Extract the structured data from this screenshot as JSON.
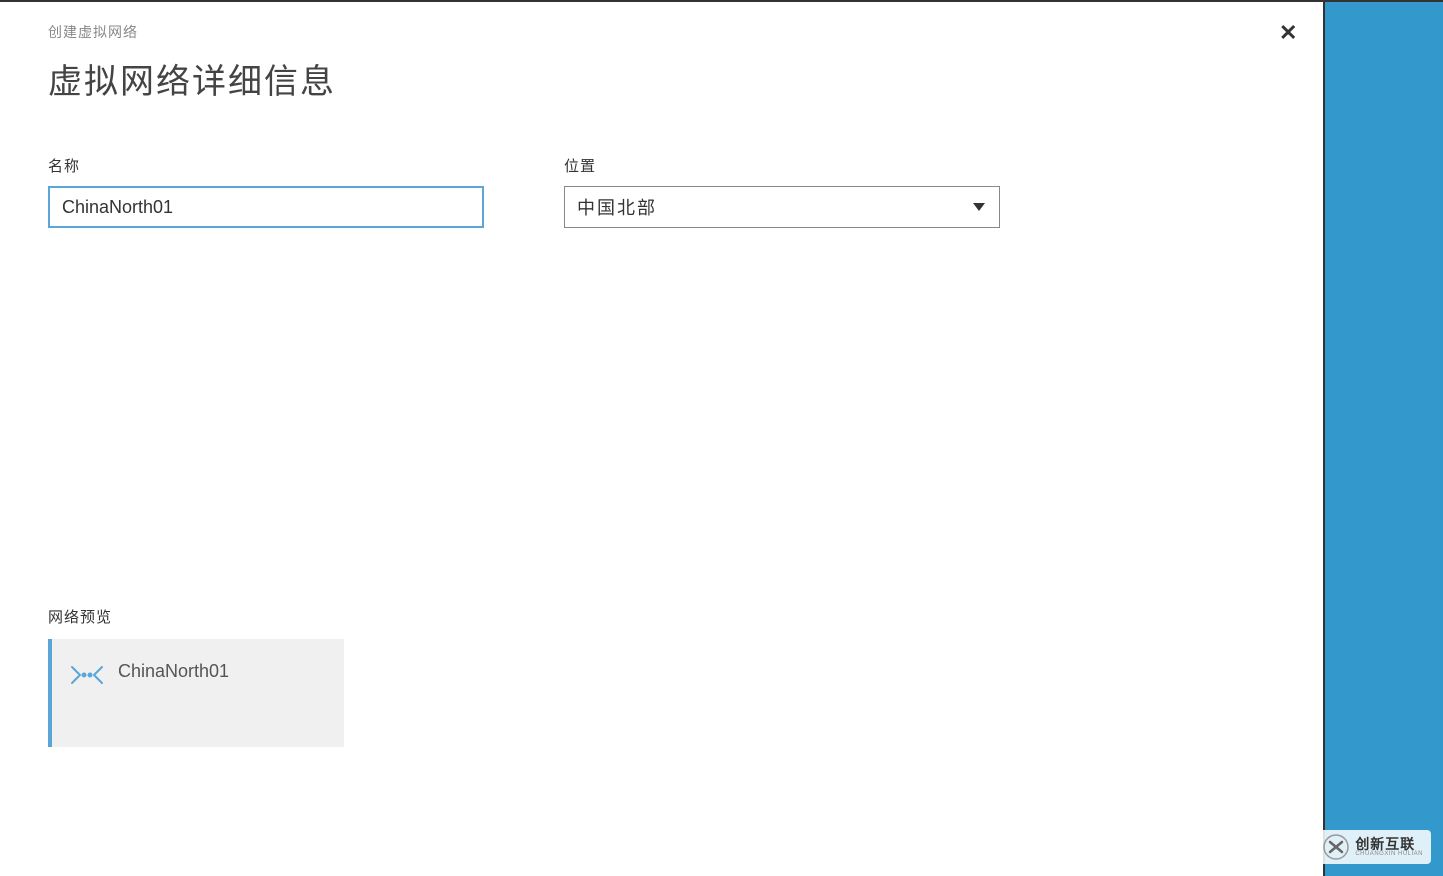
{
  "breadcrumb": "创建虚拟网络",
  "page_title": "虚拟网络详细信息",
  "close_label": "✕",
  "form": {
    "name_label": "名称",
    "name_value": "ChinaNorth01",
    "location_label": "位置",
    "location_selected": "中国北部"
  },
  "preview": {
    "label": "网络预览",
    "network_name": "ChinaNorth01"
  },
  "watermark": {
    "brand_cn": "创新互联",
    "brand_en": "CHUANGXIN HULIAN"
  },
  "colors": {
    "accent_blue": "#5aa6d8",
    "sidebar_blue": "#3399cc"
  }
}
